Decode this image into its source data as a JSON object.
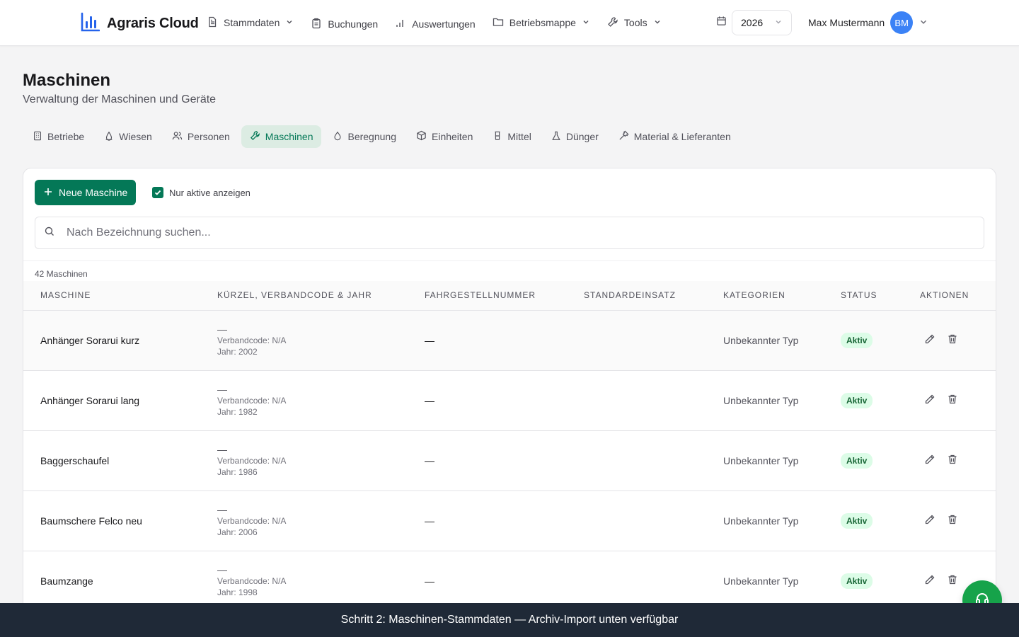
{
  "app": {
    "name": "Agraris Cloud"
  },
  "nav": {
    "items": [
      {
        "label": "Stammdaten",
        "icon": "document-icon",
        "dropdown": true
      },
      {
        "label": "Buchungen",
        "icon": "clipboard-icon",
        "dropdown": false
      },
      {
        "label": "Auswertungen",
        "icon": "bar-chart-icon",
        "dropdown": false
      },
      {
        "label": "Betriebsmappe",
        "icon": "folder-icon",
        "dropdown": true
      },
      {
        "label": "Tools",
        "icon": "wrench-icon",
        "dropdown": true
      }
    ],
    "year": "2026",
    "user_name": "Max Mustermann",
    "user_initials": "BM"
  },
  "page": {
    "title": "Maschinen",
    "subtitle": "Verwaltung der Maschinen und Geräte"
  },
  "tabs": [
    {
      "label": "Betriebe",
      "icon": "building-icon",
      "active": false
    },
    {
      "label": "Wiesen",
      "icon": "field-icon",
      "active": false
    },
    {
      "label": "Personen",
      "icon": "users-icon",
      "active": false
    },
    {
      "label": "Maschinen",
      "icon": "wrench-icon",
      "active": true
    },
    {
      "label": "Beregnung",
      "icon": "droplet-icon",
      "active": false
    },
    {
      "label": "Einheiten",
      "icon": "box-icon",
      "active": false
    },
    {
      "label": "Mittel",
      "icon": "cup-icon",
      "active": false
    },
    {
      "label": "Dünger",
      "icon": "flask-icon",
      "active": false
    },
    {
      "label": "Material & Lieferanten",
      "icon": "hammer-icon",
      "active": false
    }
  ],
  "toolbar": {
    "new_label": "Neue Maschine",
    "only_active_label": "Nur aktive anzeigen",
    "only_active_checked": true
  },
  "search": {
    "placeholder": "Nach Bezeichnung suchen..."
  },
  "count_label": "42 Maschinen",
  "table": {
    "columns": [
      "MASCHINE",
      "KÜRZEL, VERBANDCODE & JAHR",
      "FAHRGESTELLNUMMER",
      "STANDARDEINSATZ",
      "KATEGORIEN",
      "STATUS",
      "AKTIONEN"
    ],
    "rows": [
      {
        "name": "Anhänger Sorarui kurz",
        "kuerzel": "—",
        "verband": "Verbandcode: N/A",
        "jahr": "Jahr: 2002",
        "fahrgestell": "—",
        "standard": "",
        "kategorie": "Unbekannter Typ",
        "status": "Aktiv"
      },
      {
        "name": "Anhänger Sorarui lang",
        "kuerzel": "—",
        "verband": "Verbandcode: N/A",
        "jahr": "Jahr: 1982",
        "fahrgestell": "—",
        "standard": "",
        "kategorie": "Unbekannter Typ",
        "status": "Aktiv"
      },
      {
        "name": "Baggerschaufel",
        "kuerzel": "—",
        "verband": "Verbandcode: N/A",
        "jahr": "Jahr: 1986",
        "fahrgestell": "—",
        "standard": "",
        "kategorie": "Unbekannter Typ",
        "status": "Aktiv"
      },
      {
        "name": "Baumschere Felco neu",
        "kuerzel": "—",
        "verband": "Verbandcode: N/A",
        "jahr": "Jahr: 2006",
        "fahrgestell": "—",
        "standard": "",
        "kategorie": "Unbekannter Typ",
        "status": "Aktiv"
      },
      {
        "name": "Baumzange",
        "kuerzel": "—",
        "verband": "Verbandcode: N/A",
        "jahr": "Jahr: 1998",
        "fahrgestell": "—",
        "standard": "",
        "kategorie": "Unbekannter Typ",
        "status": "Aktiv"
      }
    ]
  },
  "footer": {
    "text": "Schritt 2: Maschinen-Stammdaten — Archiv-Import unten verfügbar"
  },
  "colors": {
    "primary": "#047857",
    "avatar": "#3b82f6",
    "badge_bg": "#dcfce7",
    "badge_text": "#166534",
    "fab": "#16a34a",
    "footer_bg": "#1f2937"
  }
}
